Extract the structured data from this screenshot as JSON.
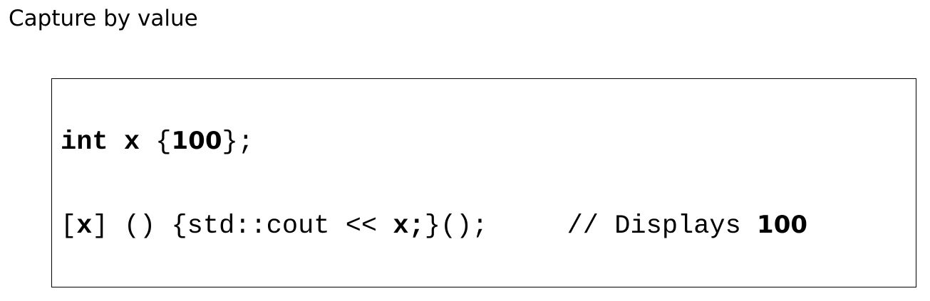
{
  "title": "Capture by value",
  "code": {
    "line1": {
      "kw_int": "int",
      "sp1": " ",
      "var_x": "x",
      "sp2": " ",
      "open_brace": "{",
      "value": "100",
      "close": "};"
    },
    "line2": {
      "open_bracket": "[",
      "capture": "x",
      "after_capture": "] () {std::cout << ",
      "stmt": "x;",
      "after_stmt": "}();",
      "gap": "     ",
      "comment": "// Displays ",
      "comment_value": "100"
    }
  }
}
